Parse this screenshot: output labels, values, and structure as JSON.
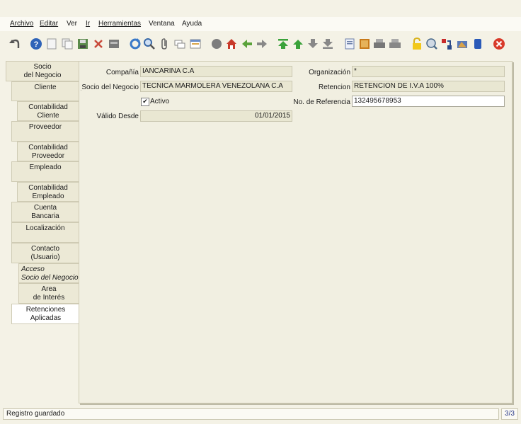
{
  "menu": [
    {
      "label": "Archivo"
    },
    {
      "label": "Editar"
    },
    {
      "label": "Ver"
    },
    {
      "label": "Ir"
    },
    {
      "label": "Herramientas"
    },
    {
      "label": "Ventana"
    },
    {
      "label": "Ayuda"
    }
  ],
  "toolbar_icons": [
    "undo-icon",
    "help-icon",
    "new-icon",
    "copy-icon",
    "save-icon",
    "delete-icon",
    "print-preview-icon",
    "refresh-icon",
    "find-icon",
    "attachment-icon",
    "chat-icon",
    "history-icon",
    "report-icon",
    "home-icon",
    "back-icon",
    "forward-icon",
    "first-icon",
    "up-icon",
    "down-icon",
    "last-icon",
    "detail-icon",
    "archive-icon",
    "print-icon",
    "print-all-icon",
    "lock-icon",
    "zoom-icon",
    "workflow-icon",
    "process-icon",
    "product-icon",
    "exit-icon"
  ],
  "tabs": [
    {
      "label1": "Socio",
      "label2": "del Negocio"
    },
    {
      "label1": "Cliente",
      "label2": ""
    },
    {
      "label1": "Contabilidad",
      "label2": "Cliente"
    },
    {
      "label1": "Proveedor",
      "label2": ""
    },
    {
      "label1": "Contabilidad",
      "label2": "Proveedor"
    },
    {
      "label1": "Empleado",
      "label2": ""
    },
    {
      "label1": "Contabilidad",
      "label2": "Empleado"
    },
    {
      "label1": "Cuenta",
      "label2": "Bancaria"
    },
    {
      "label1": "Localización",
      "label2": ""
    },
    {
      "label1": "Contacto",
      "label2": "(Usuario)"
    },
    {
      "label1": "Acceso",
      "label2": "Socio del Negocio"
    },
    {
      "label1": "Area",
      "label2": "de Interés"
    },
    {
      "label1": "Retenciones",
      "label2": "Aplicadas"
    }
  ],
  "form": {
    "compania_label": "Compañía",
    "compania_value": "IANCARINA C.A",
    "socio_label": "Socio del Negocio",
    "socio_value": "TECNICA MARMOLERA VENEZOLANA C.A",
    "activo_label": "Activo",
    "activo_checked": "✔",
    "valido_label": "Válido Desde",
    "valido_value": "01/01/2015",
    "organizacion_label": "Organización",
    "organizacion_value": "*",
    "retencion_label": "Retencion",
    "retencion_value": "RETENCION DE I.V.A 100%",
    "referencia_label": "No. de Referencia",
    "referencia_value": "132495678953"
  },
  "status": {
    "message": "Registro guardado",
    "pager": "3/3"
  }
}
